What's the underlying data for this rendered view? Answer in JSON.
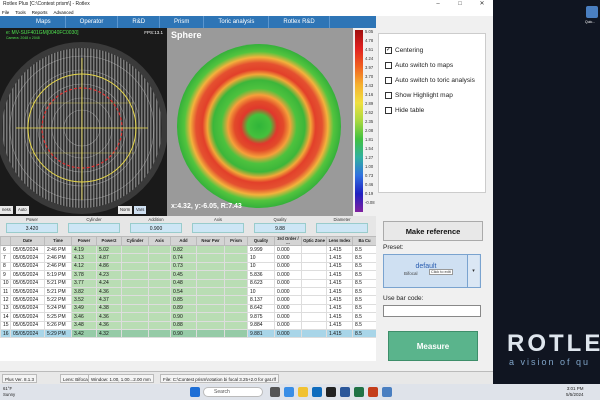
{
  "window": {
    "title": "Rotlex Plus [C:\\Contest prism\\] - Rotlex",
    "controls": [
      "–",
      "□",
      "✕"
    ]
  },
  "menu": [
    "File",
    "Tools",
    "Reports",
    "Advanced"
  ],
  "tabs": [
    "Maps",
    "Operator",
    "R&D",
    "Prism",
    "Toric analysis",
    "Rotlex R&D"
  ],
  "camera": {
    "label": "e: MV-SUF401GM[0040FC0030]",
    "sublabel": "Camera: 2048 x 2048",
    "fps": "FPS:13.1",
    "buttons": [
      "ness",
      "Auto",
      "Norm",
      "Vars"
    ]
  },
  "map": {
    "title": "Sphere",
    "coords": "x:4.32, y:-6.05, R:7.43"
  },
  "scale": {
    "labels": [
      "5.05",
      "4.78",
      "4.51",
      "4.24",
      "3.97",
      "3.70",
      "3.43",
      "3.16",
      "2.89",
      "2.62",
      "2.35",
      "2.08",
      "1.81",
      "1.54",
      "1.27",
      "1.00",
      "0.73",
      "0.46",
      "0.19",
      "-0.08"
    ]
  },
  "options": [
    {
      "label": "Centering",
      "checked": true
    },
    {
      "label": "Auto switch to maps",
      "checked": false
    },
    {
      "label": "Auto switch to toric analysis",
      "checked": false
    },
    {
      "label": "Show Highlight map",
      "checked": false
    },
    {
      "label": "Hide table",
      "checked": false
    }
  ],
  "readings": [
    {
      "label": "Power",
      "value": "3.420"
    },
    {
      "label": "Cylinder",
      "value": ""
    },
    {
      "label": "Addition",
      "value": "0.900"
    },
    {
      "label": "Axis",
      "value": ""
    },
    {
      "label": "Quality",
      "value": "9.88"
    },
    {
      "label": "Diameter",
      "value": ""
    }
  ],
  "table": {
    "headers": [
      "",
      "Date",
      "Time",
      "Power",
      "Power2",
      "Cylinder",
      "Axis",
      "Add",
      "Near Pwr",
      "Prism",
      "Quality",
      "3rd Order / ...",
      "Optic Zone",
      "Lens Index",
      "Ba Cu"
    ],
    "rows": [
      [
        "6",
        "05/05/2024",
        "2:46 PM",
        "4.19",
        "5.02",
        "",
        "",
        "0.82",
        "",
        "",
        "9.999",
        "0.000",
        "",
        "1.415",
        "8.5"
      ],
      [
        "7",
        "05/05/2024",
        "2:46 PM",
        "4.13",
        "4.87",
        "",
        "",
        "0.74",
        "",
        "",
        "10",
        "0.000",
        "",
        "1.415",
        "8.5"
      ],
      [
        "8",
        "05/05/2024",
        "2:46 PM",
        "4.12",
        "4.86",
        "",
        "",
        "0.73",
        "",
        "",
        "10",
        "0.000",
        "",
        "1.415",
        "8.5"
      ],
      [
        "9",
        "05/05/2024",
        "5:19 PM",
        "3.78",
        "4.23",
        "",
        "",
        "0.45",
        "",
        "",
        "5.836",
        "0.000",
        "",
        "1.415",
        "8.5"
      ],
      [
        "10",
        "05/05/2024",
        "5:21 PM",
        "3.77",
        "4.24",
        "",
        "",
        "0.48",
        "",
        "",
        "8.623",
        "0.000",
        "",
        "1.415",
        "8.5"
      ],
      [
        "11",
        "05/05/2024",
        "5:21 PM",
        "3.82",
        "4.36",
        "",
        "",
        "0.54",
        "",
        "",
        "10",
        "0.000",
        "",
        "1.415",
        "8.5"
      ],
      [
        "12",
        "05/05/2024",
        "5:22 PM",
        "3.52",
        "4.37",
        "",
        "",
        "0.85",
        "",
        "",
        "8.137",
        "0.000",
        "",
        "1.415",
        "8.5"
      ],
      [
        "13",
        "05/05/2024",
        "5:24 PM",
        "3.49",
        "4.38",
        "",
        "",
        "0.89",
        "",
        "",
        "8.642",
        "0.000",
        "",
        "1.415",
        "8.5"
      ],
      [
        "14",
        "05/05/2024",
        "5:25 PM",
        "3.46",
        "4.36",
        "",
        "",
        "0.90",
        "",
        "",
        "9.875",
        "0.000",
        "",
        "1.415",
        "8.5"
      ],
      [
        "15",
        "05/05/2024",
        "5:26 PM",
        "3.48",
        "4.36",
        "",
        "",
        "0.88",
        "",
        "",
        "9.884",
        "0.000",
        "",
        "1.415",
        "8.5"
      ],
      [
        "16",
        "05/05/2024",
        "5:29 PM",
        "3.42",
        "4.32",
        "",
        "",
        "0.90",
        "",
        "",
        "9.881",
        "0.000",
        "",
        "1.415",
        "8.5"
      ]
    ]
  },
  "right": {
    "make_reference": "Make reference",
    "preset_label": "Preset:",
    "preset_value": "default",
    "preset_sub": "Bifocal",
    "preset_tooltip": "Click to edit",
    "barcode_label": "Use bar code:",
    "measure": "Measure"
  },
  "status": [
    "Plus Ver. 8.1.3",
    "Lens: Bifocal",
    "Window: 1.00, 1.00...2.00 mm",
    "File: C:\\Contest prism\\rotation bi focal 3.25+2.0 for gat.rlf"
  ],
  "desktop": {
    "icon_label": "Quic...",
    "brand": "ROTLEX",
    "tagline": "a vision of qu"
  },
  "taskbar": {
    "weather": [
      "61°F",
      "Sunny"
    ],
    "search_placeholder": "Search",
    "time": "3:01 PM",
    "date": "5/5/2024"
  }
}
